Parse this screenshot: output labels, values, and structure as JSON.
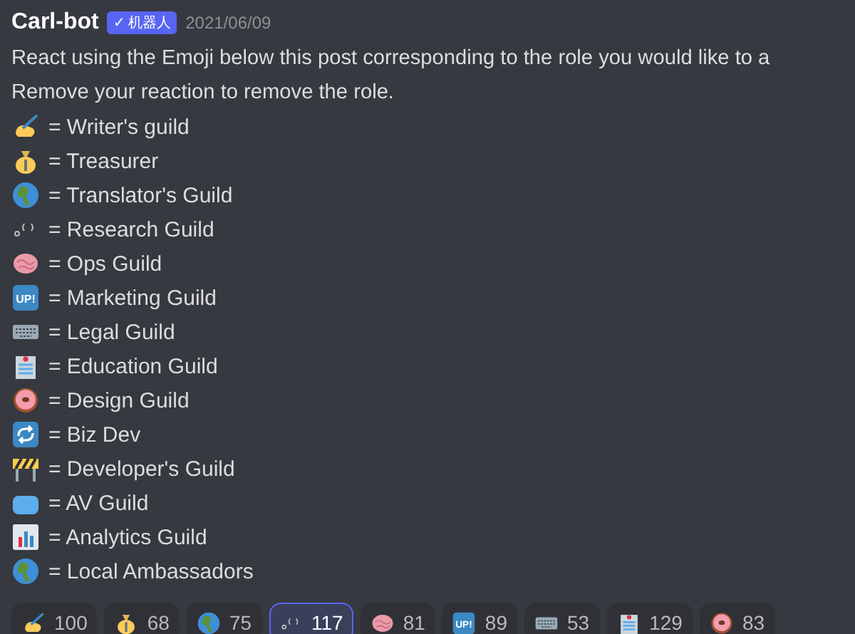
{
  "message": {
    "author": "Carl-bot",
    "badge": {
      "check": "✓",
      "label": "机器人"
    },
    "timestamp": "2021/06/09",
    "lines": [
      "React using the Emoji below this post corresponding to the role you would like to a",
      "Remove your reaction to remove the role."
    ]
  },
  "roles": [
    {
      "emoji": {
        "kind": "writing-hand"
      },
      "text": "= Writer's guild"
    },
    {
      "emoji": {
        "kind": "money-bag"
      },
      "text": "= Treasurer"
    },
    {
      "emoji": {
        "kind": "globe"
      },
      "text": "= Translator's Guild"
    },
    {
      "emoji": {
        "kind": "kaomoji"
      },
      "text": "= Research Guild"
    },
    {
      "emoji": {
        "kind": "brain"
      },
      "text": "= Ops Guild"
    },
    {
      "emoji": {
        "kind": "up-sign",
        "label": "UP!"
      },
      "text": "= Marketing Guild"
    },
    {
      "emoji": {
        "kind": "keyboard"
      },
      "text": "= Legal Guild"
    },
    {
      "emoji": {
        "kind": "office"
      },
      "text": "= Education Guild"
    },
    {
      "emoji": {
        "kind": "donut"
      },
      "text": "= Design Guild"
    },
    {
      "emoji": {
        "kind": "repeat"
      },
      "text": "= Biz Dev"
    },
    {
      "emoji": {
        "kind": "barrier"
      },
      "text": "= Developer's Guild"
    },
    {
      "emoji": {
        "kind": "blob"
      },
      "text": "= AV Guild"
    },
    {
      "emoji": {
        "kind": "chart"
      },
      "text": "= Analytics Guild"
    },
    {
      "emoji": {
        "kind": "globe"
      },
      "text": "= Local Ambassadors"
    }
  ],
  "reactions": [
    {
      "emoji": {
        "kind": "writing-hand"
      },
      "count": "100",
      "selected": false
    },
    {
      "emoji": {
        "kind": "money-bag"
      },
      "count": "68",
      "selected": false
    },
    {
      "emoji": {
        "kind": "globe"
      },
      "count": "75",
      "selected": false
    },
    {
      "emoji": {
        "kind": "kaomoji"
      },
      "count": "117",
      "selected": true
    },
    {
      "emoji": {
        "kind": "brain"
      },
      "count": "81",
      "selected": false
    },
    {
      "emoji": {
        "kind": "up-sign",
        "label": "UP!"
      },
      "count": "89",
      "selected": false
    },
    {
      "emoji": {
        "kind": "keyboard"
      },
      "count": "53",
      "selected": false
    },
    {
      "emoji": {
        "kind": "office"
      },
      "count": "129",
      "selected": false
    },
    {
      "emoji": {
        "kind": "donut"
      },
      "count": "83",
      "selected": false
    }
  ]
}
